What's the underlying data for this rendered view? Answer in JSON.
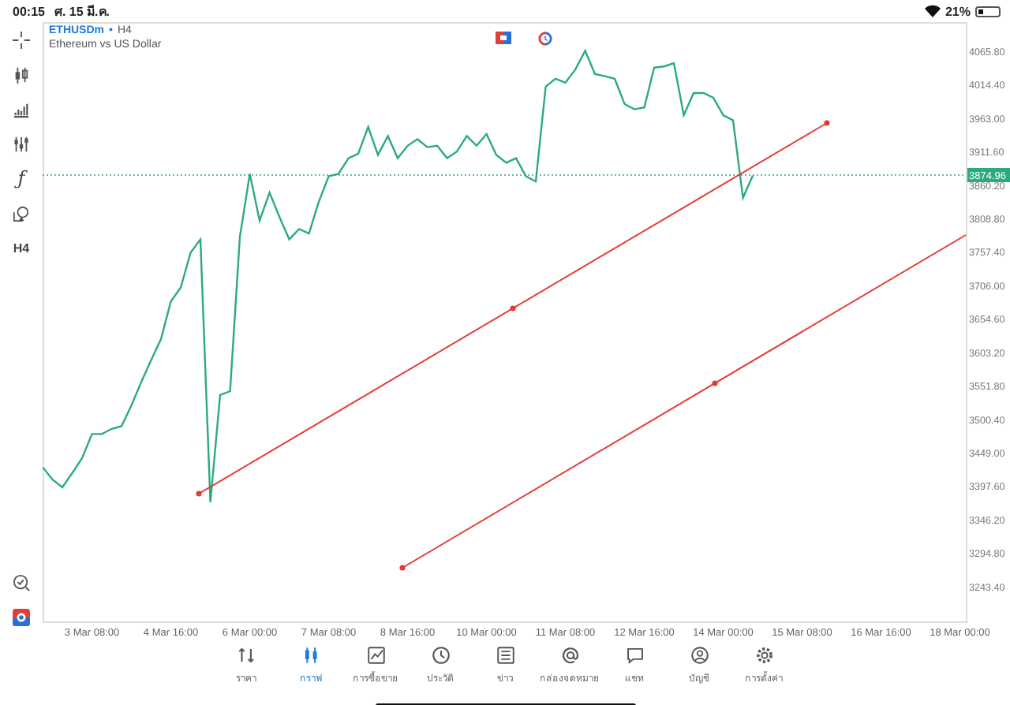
{
  "status_bar": {
    "time": "00:15",
    "date": "ศ. 15 มี.ค.",
    "battery": "21%"
  },
  "left_toolbar": {
    "function_button": "ƒ",
    "timeframe_button": "H4"
  },
  "chart": {
    "symbol": "ETHUSDm",
    "separator": "•",
    "timeframe": "H4",
    "description": "Ethereum vs US Dollar",
    "last_price": "3874.96",
    "chart_data": {
      "type": "line",
      "ylim": [
        3187.6,
        4111.1
      ],
      "categories": [
        null,
        null,
        null,
        null,
        null,
        "3 Mar 08:00",
        null,
        null,
        null,
        null,
        null,
        null,
        null,
        "4 Mar 16:00",
        null,
        null,
        null,
        null,
        null,
        null,
        null,
        "6 Mar 00:00",
        null,
        null,
        null,
        null,
        null,
        null,
        null,
        "7 Mar 08:00",
        null,
        null,
        null,
        null,
        null,
        null,
        null,
        "8 Mar 16:00",
        null,
        null,
        null,
        null,
        null,
        null,
        null,
        "10 Mar 00:00",
        null,
        null,
        null,
        null,
        null,
        null,
        null,
        "11 Mar 08:00",
        null,
        null,
        null,
        null,
        null,
        null,
        null,
        "12 Mar 16:00",
        null,
        null,
        null,
        null,
        null,
        null,
        null,
        "14 Mar 00:00",
        null,
        null,
        null,
        null,
        null,
        null,
        null,
        "15 Mar 08:00",
        null,
        null,
        null,
        null,
        null,
        null,
        null,
        "16 Mar 16:00",
        null,
        null,
        null,
        null,
        null,
        null,
        null,
        "18 Mar 00:00"
      ],
      "series": [
        {
          "color": "#2bab7c",
          "values": [
            3427,
            3408,
            3396,
            3418,
            3441,
            3478,
            3478,
            3486,
            3490,
            3522,
            3558,
            3592,
            3624,
            3682,
            3703,
            3757,
            3777,
            3373,
            3538,
            3544,
            3781,
            3878,
            3806,
            3849,
            3812,
            3777,
            3793,
            3786,
            3835,
            3874,
            3878,
            3902,
            3909,
            3950,
            3907,
            3936,
            3902,
            3921,
            3931,
            3919,
            3921,
            3902,
            3912,
            3936,
            3921,
            3939,
            3907,
            3895,
            3902,
            3874,
            3866,
            4012,
            4024,
            4018,
            4038,
            4067,
            4031,
            4028,
            4024,
            3985,
            3977,
            3980,
            4041,
            4043,
            4048,
            3968,
            4002,
            4002,
            3995,
            3968,
            3960,
            3841,
            3875,
            null,
            null,
            null,
            null,
            null,
            null,
            null,
            null,
            null,
            null,
            null,
            null,
            null,
            null,
            null,
            null,
            null,
            null,
            null,
            null,
            null
          ]
        }
      ],
      "yticks": [
        {
          "value": 4065.8,
          "label": "4065.80"
        },
        {
          "value": 4014.4,
          "label": "4014.40"
        },
        {
          "value": 3963.0,
          "label": "3963.00"
        },
        {
          "value": 3911.6,
          "label": "3911.60"
        },
        {
          "value": 3860.2,
          "label": "3860.20"
        },
        {
          "value": 3808.8,
          "label": "3808.80"
        },
        {
          "value": 3757.4,
          "label": "3757.40"
        },
        {
          "value": 3706.0,
          "label": "3706.00"
        },
        {
          "value": 3654.6,
          "label": "3654.60"
        },
        {
          "value": 3603.2,
          "label": "3603.20"
        },
        {
          "value": 3551.8,
          "label": "3551.80"
        },
        {
          "value": 3500.4,
          "label": "3500.40"
        },
        {
          "value": 3449.0,
          "label": "3449.00"
        },
        {
          "value": 3397.6,
          "label": "3397.60"
        },
        {
          "value": 3346.2,
          "label": "3346.20"
        },
        {
          "value": 3294.8,
          "label": "3294.80"
        },
        {
          "value": 3243.4,
          "label": "3243.40"
        }
      ]
    }
  },
  "tab_bar": [
    {
      "label": "ราคา",
      "selected": false
    },
    {
      "label": "กราฟ",
      "selected": true
    },
    {
      "label": "การซื้อขาย",
      "selected": false
    },
    {
      "label": "ประวัติ",
      "selected": false
    },
    {
      "label": "ข่าว",
      "selected": false
    },
    {
      "label": "กล่องจดหมาย",
      "selected": false
    },
    {
      "label": "แชท",
      "selected": false
    },
    {
      "label": "บัญชี",
      "selected": false
    },
    {
      "label": "การตั้งค่า",
      "selected": false
    }
  ]
}
